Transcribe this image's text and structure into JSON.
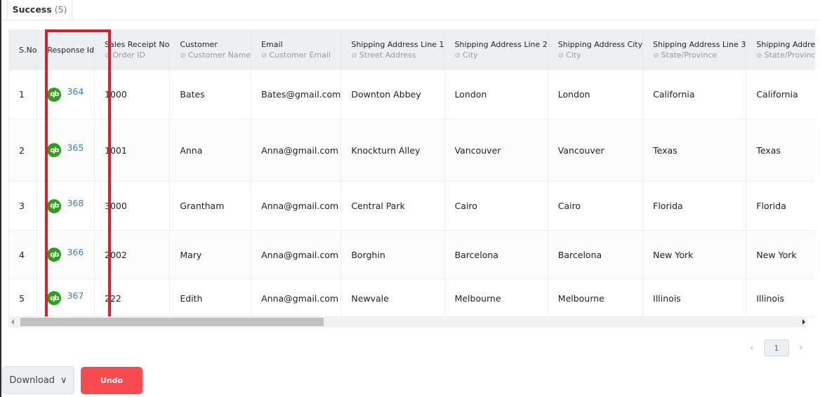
{
  "tabs": [
    {
      "label": "Success",
      "count": "(5)",
      "active": true
    }
  ],
  "table": {
    "columns": [
      {
        "title": "S.No",
        "mapped": ""
      },
      {
        "title": "Response Id",
        "mapped": ""
      },
      {
        "title": "Sales Receipt No",
        "mapped": "Order ID"
      },
      {
        "title": "Customer",
        "mapped": "Customer Name"
      },
      {
        "title": "Email",
        "mapped": "Customer Email"
      },
      {
        "title": "Shipping Address Line 1",
        "mapped": "Street Address"
      },
      {
        "title": "Shipping Address Line 2",
        "mapped": "City"
      },
      {
        "title": "Shipping Address City",
        "mapped": "City"
      },
      {
        "title": "Shipping Address Line 3",
        "mapped": "State/Province"
      },
      {
        "title": "Shipping Address State",
        "mapped": "State/Province"
      }
    ],
    "rows": [
      {
        "sno": "1",
        "response_id": "364",
        "receipt": "1000",
        "customer": "Bates",
        "email": "Bates@gmail.com",
        "line1": "Downton Abbey",
        "line2": "London",
        "city": "London",
        "line3": "California",
        "state": "California"
      },
      {
        "sno": "2",
        "response_id": "365",
        "receipt": "1001",
        "customer": "Anna",
        "email": "Anna@gmail.com",
        "line1": "Knockturn Alley",
        "line2": "Vancouver",
        "city": "Vancouver",
        "line3": "Texas",
        "state": "Texas"
      },
      {
        "sno": "3",
        "response_id": "368",
        "receipt": "3000",
        "customer": "Grantham",
        "email": "Anna@gmail.com",
        "line1": "Central Park",
        "line2": "Cairo",
        "city": "Cairo",
        "line3": "Florida",
        "state": "Florida"
      },
      {
        "sno": "4",
        "response_id": "366",
        "receipt": "2002",
        "customer": "Mary",
        "email": "Anna@gmail.com",
        "line1": "Borghin",
        "line2": "Barcelona",
        "city": "Barcelona",
        "line3": "New York",
        "state": "New York"
      },
      {
        "sno": "5",
        "response_id": "367",
        "receipt": "222",
        "customer": "Edith",
        "email": "Anna@gmail.com",
        "line1": "Newvale",
        "line2": "Melbourne",
        "city": "Melbourne",
        "line3": "Illinois",
        "state": "Illinois"
      }
    ],
    "response_icon": "quickbooks-icon",
    "response_icon_text": "qb"
  },
  "pagination": {
    "current_page": "1",
    "prev": "‹",
    "next": "›"
  },
  "actions": {
    "download_label": "Download",
    "download_chevron": "∨",
    "undo_label": "Undo"
  },
  "colors": {
    "highlight": "#d7202a",
    "undo": "#f74b50",
    "qb_green": "#2ca01c",
    "link": "#3a7bc8"
  }
}
